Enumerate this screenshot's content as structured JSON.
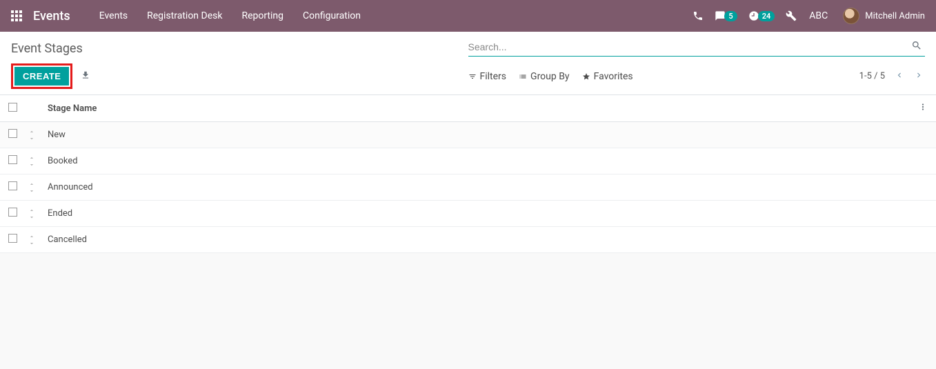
{
  "navbar": {
    "brand": "Events",
    "links": [
      "Events",
      "Registration Desk",
      "Reporting",
      "Configuration"
    ],
    "messages_badge": "5",
    "activities_badge": "24",
    "company": "ABC",
    "user_name": "Mitchell Admin"
  },
  "breadcrumb": "Event Stages",
  "search": {
    "placeholder": "Search..."
  },
  "buttons": {
    "create": "CREATE"
  },
  "filters": {
    "filters": "Filters",
    "group_by": "Group By",
    "favorites": "Favorites"
  },
  "pager": {
    "text": "1-5 / 5"
  },
  "table": {
    "header": "Stage Name",
    "rows": [
      "New",
      "Booked",
      "Announced",
      "Ended",
      "Cancelled"
    ]
  }
}
